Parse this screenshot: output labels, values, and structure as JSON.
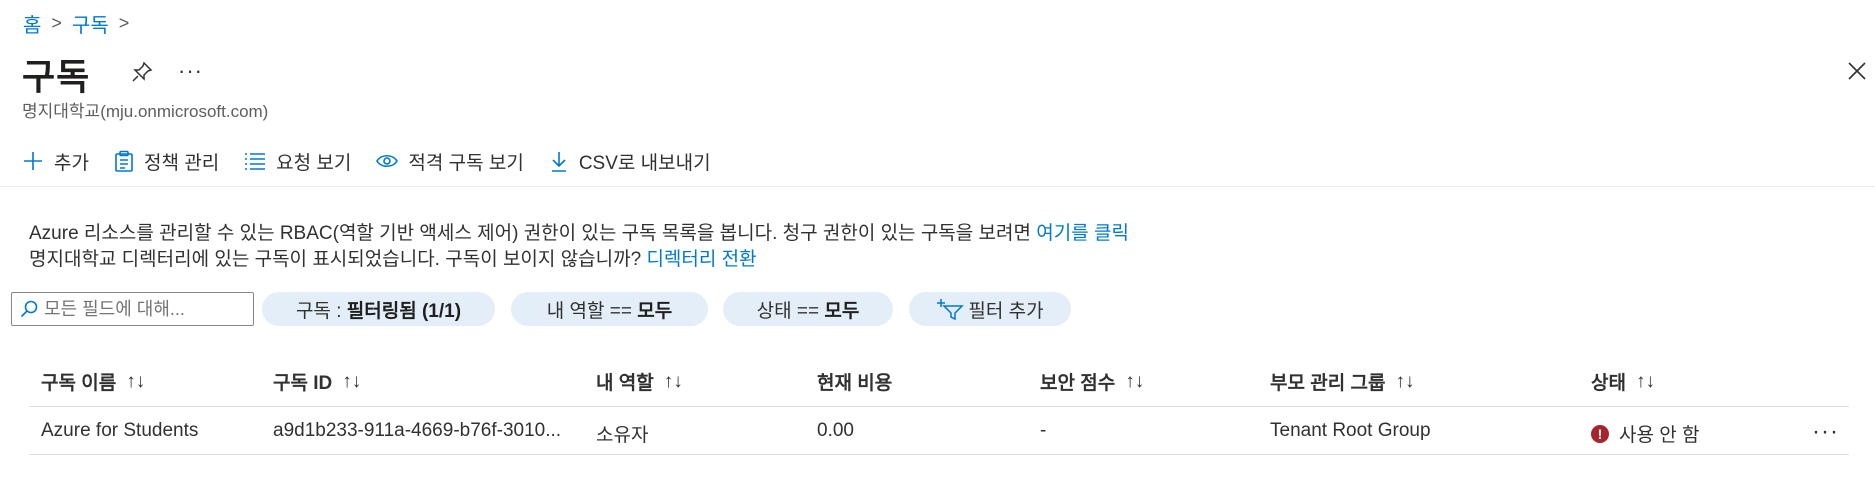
{
  "breadcrumb": {
    "home": "홈",
    "current": "구독",
    "separator": ">"
  },
  "header": {
    "title": "구독",
    "more": "···",
    "subtitle": "명지대학교(mju.onmicrosoft.com)"
  },
  "toolbar": {
    "add": "추가",
    "policy": "정책 관리",
    "requests": "요청 보기",
    "eligible": "적격 구독 보기",
    "export": "CSV로 내보내기"
  },
  "info": {
    "line1_text": "Azure 리소스를 관리할 수 있는 RBAC(역할 기반 액세스 제어) 권한이 있는 구독 목록을 봅니다. 청구 권한이 있는 구독을 보려면 ",
    "line1_link": "여기를 클릭",
    "line2_text": "명지대학교 디렉터리에 있는 구독이 표시되었습니다. 구독이 보이지 않습니까? ",
    "line2_link": "디렉터리 전환"
  },
  "filters": {
    "search_placeholder": "모든 필드에 대해...",
    "subscription_label": "구독 : ",
    "subscription_value": "필터링됨 (1/1)",
    "role_label": "내 역할 == ",
    "role_value": "모두",
    "state_label": "상태 == ",
    "state_value": "모두",
    "add_filter": "필터 추가"
  },
  "table": {
    "sort_glyph": "↑↓",
    "headers": {
      "name": "구독 이름",
      "id": "구독 ID",
      "role": "내 역할",
      "cost": "현재 비용",
      "score": "보안 점수",
      "group": "부모 관리 그룹",
      "status": "상태"
    },
    "rows": [
      {
        "name": "Azure for Students",
        "id": "a9d1b233-911a-4669-b76f-3010...",
        "role": "소유자",
        "cost": "0.00",
        "score": "-",
        "group": "Tenant Root Group",
        "status": "사용 안 함",
        "status_icon": "!",
        "more": "···"
      }
    ]
  },
  "colors": {
    "accent": "#0078d4",
    "pill_bg": "#e3eef9",
    "error": "#a4262c"
  }
}
